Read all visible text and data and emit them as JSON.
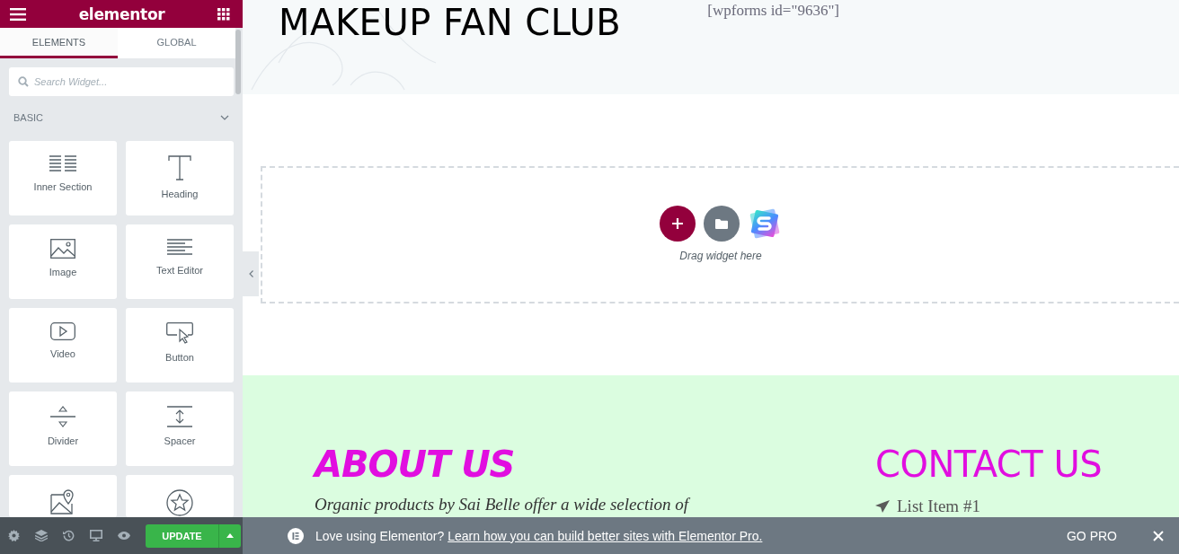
{
  "panel": {
    "logo": "elementor",
    "tabs": [
      {
        "label": "ELEMENTS",
        "selected": true
      },
      {
        "label": "GLOBAL",
        "selected": false
      }
    ],
    "search": {
      "placeholder": "Search Widget..."
    },
    "category": {
      "label": "BASIC",
      "expanded": true
    },
    "widgets": [
      {
        "kind": "inner-section",
        "label": "Inner Section"
      },
      {
        "kind": "heading",
        "label": "Heading"
      },
      {
        "kind": "image",
        "label": "Image"
      },
      {
        "kind": "text-editor",
        "label": "Text Editor"
      },
      {
        "kind": "video",
        "label": "Video"
      },
      {
        "kind": "button",
        "label": "Button"
      },
      {
        "kind": "divider",
        "label": "Divider"
      },
      {
        "kind": "spacer",
        "label": "Spacer"
      },
      {
        "kind": "map"
      },
      {
        "kind": "star"
      }
    ],
    "update_button": "UPDATE"
  },
  "page": {
    "title": "MAKEUP FAN CLUB",
    "shortcode": "[wpforms id=\"9636\"]",
    "drop_zone": {
      "hint": "Drag widget here"
    },
    "about": {
      "heading": "ABOUT US",
      "text": "Organic products by Sai Belle offer a wide selection of"
    },
    "contact": {
      "heading": "CONTACT US",
      "items": [
        "List Item #1"
      ]
    }
  },
  "notice": {
    "text": "Love using Elementor?",
    "link": "Learn how you can build better sites with Elementor Pro.",
    "action": "GO PRO"
  }
}
